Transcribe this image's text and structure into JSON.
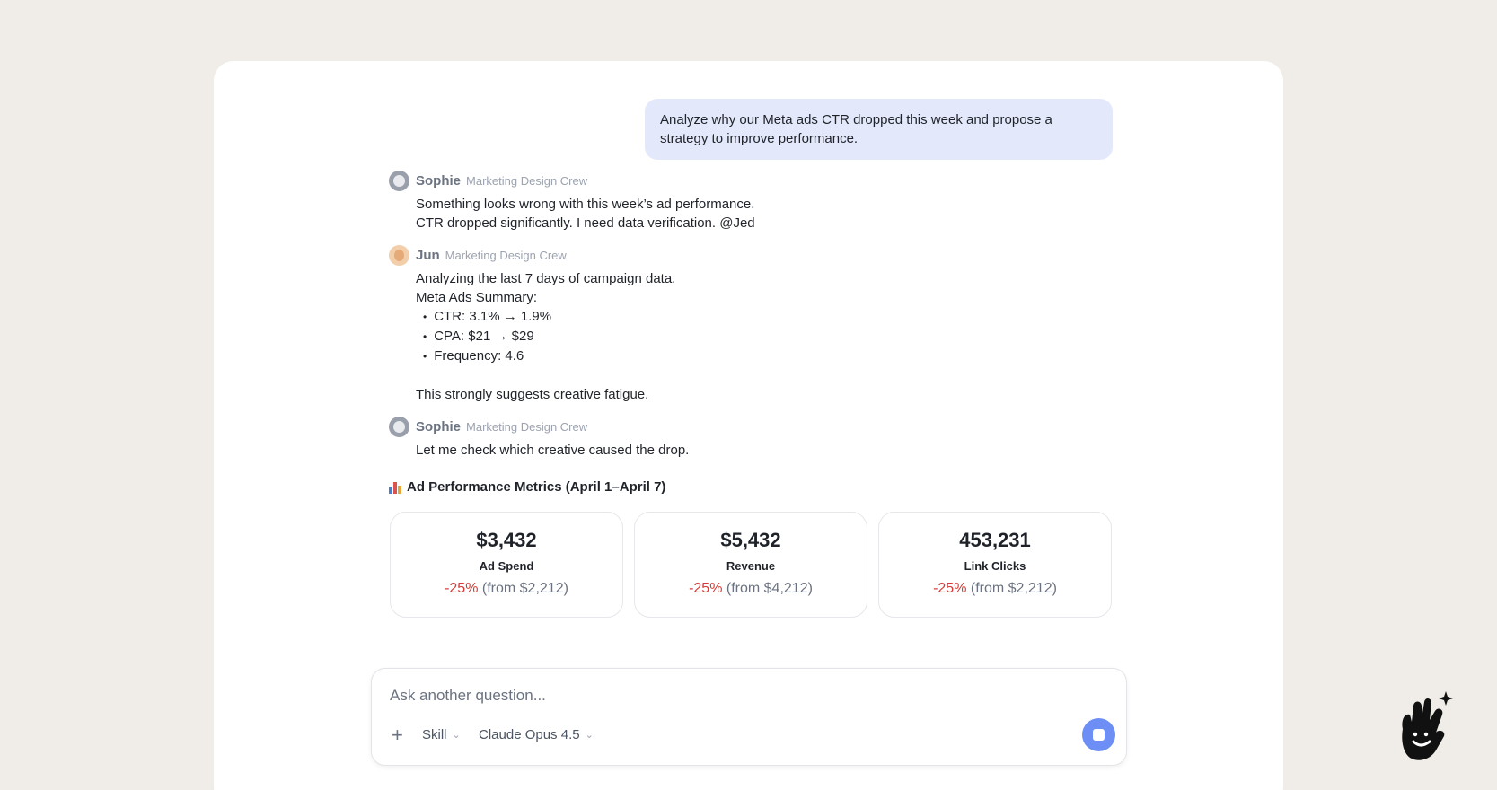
{
  "user_message": "Analyze why our Meta ads CTR dropped this week and propose a strategy to improve performance.",
  "messages": [
    {
      "sender": "Sophie",
      "crew": "Marketing Design Crew",
      "lines": [
        "Something looks wrong with this week’s ad performance.",
        "CTR dropped significantly. I need data verification. @Jed"
      ]
    },
    {
      "sender": "Jun",
      "crew": "Marketing Design Crew",
      "lines": [
        "Analyzing the last 7 days of campaign data.",
        "Meta Ads Summary:"
      ],
      "bullets": [
        "CTR: 3.1% → 1.9%",
        "CPA: $21 → $29",
        "Frequency: 4.6"
      ],
      "footer": "This strongly suggests creative fatigue."
    },
    {
      "sender": "Sophie",
      "crew": "Marketing Design Crew",
      "lines": [
        "Let me check which creative caused the drop."
      ]
    }
  ],
  "metrics": {
    "title": "Ad Performance Metrics (April 1–April 7)",
    "icon": "bar-chart-icon",
    "cards": [
      {
        "value": "$3,432",
        "label": "Ad Spend",
        "change": "-25%",
        "from": "(from $2,212)"
      },
      {
        "value": "$5,432",
        "label": "Revenue",
        "change": "-25%",
        "from": "(from $4,212)"
      },
      {
        "value": "453,231",
        "label": "Link Clicks",
        "change": "-25%",
        "from": "(from $2,212)"
      }
    ]
  },
  "composer": {
    "placeholder": "Ask another question...",
    "value": "",
    "add_icon": "plus-icon",
    "skill_label": "Skill",
    "model_label": "Claude Opus 4.5",
    "stop_icon": "stop-icon"
  },
  "colors": {
    "background": "#f0ede8",
    "user_bubble": "#e3e8fb",
    "accent": "#6d8ff5",
    "negative": "#d63b3b"
  }
}
